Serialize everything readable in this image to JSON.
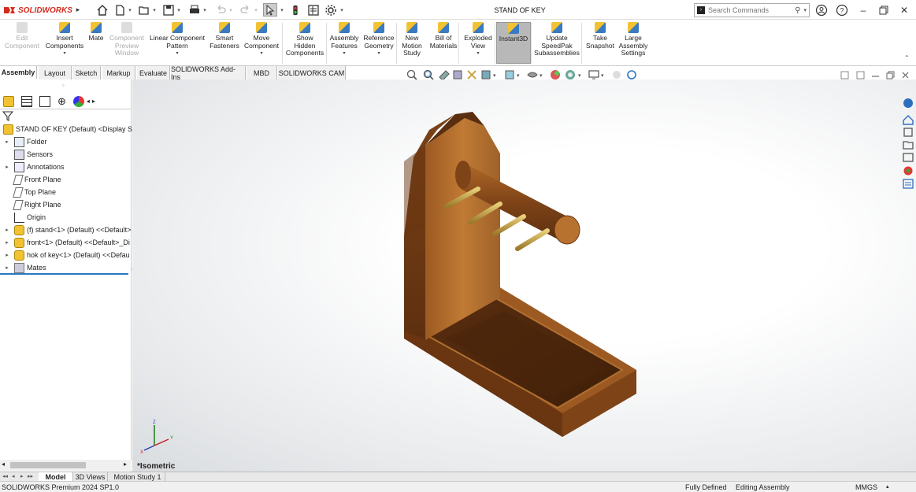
{
  "app": {
    "logo_text": "SOLIDWORKS",
    "document_title": "STAND OF KEY"
  },
  "search": {
    "placeholder": "Search Commands"
  },
  "ribbon": {
    "buttons": [
      {
        "label": "Edit\nComponent",
        "enabled": false
      },
      {
        "label": "Insert\nComponents",
        "enabled": true
      },
      {
        "label": "Mate",
        "enabled": true
      },
      {
        "label": "Component\nPreview\nWindow",
        "enabled": false
      },
      {
        "label": "Linear Component\nPattern",
        "enabled": true
      },
      {
        "label": "Smart\nFasteners",
        "enabled": true
      },
      {
        "label": "Move\nComponent",
        "enabled": true
      },
      {
        "label": "Show\nHidden\nComponents",
        "enabled": true
      },
      {
        "label": "Assembly\nFeatures",
        "enabled": true
      },
      {
        "label": "Reference\nGeometry",
        "enabled": true
      },
      {
        "label": "New\nMotion\nStudy",
        "enabled": true
      },
      {
        "label": "Bill of\nMaterials",
        "enabled": true
      },
      {
        "label": "Exploded\nView",
        "enabled": true
      },
      {
        "label": "Instant3D",
        "enabled": true,
        "active": true
      },
      {
        "label": "Update\nSpeedPak\nSubassemblies",
        "enabled": true
      },
      {
        "label": "Take\nSnapshot",
        "enabled": true
      },
      {
        "label": "Large\nAssembly\nSettings",
        "enabled": true
      }
    ]
  },
  "tabs": [
    "Assembly",
    "Layout",
    "Sketch",
    "Markup",
    "Evaluate",
    "SOLIDWORKS Add-Ins",
    "MBD",
    "SOLIDWORKS CAM"
  ],
  "tree": {
    "root": "STAND OF KEY (Default) <Display Stat",
    "items": [
      {
        "label": "Folder",
        "expand": true
      },
      {
        "label": "Sensors",
        "expand": false
      },
      {
        "label": "Annotations",
        "expand": true
      },
      {
        "label": "Front Plane",
        "expand": false
      },
      {
        "label": "Top Plane",
        "expand": false
      },
      {
        "label": "Right Plane",
        "expand": false
      },
      {
        "label": "Origin",
        "expand": false
      },
      {
        "label": "(f) stand<1> (Default) <<Default>",
        "expand": true
      },
      {
        "label": "front<1> (Default) <<Default>_Di",
        "expand": true
      },
      {
        "label": "hok of key<1> (Default) <<Defau",
        "expand": true
      },
      {
        "label": "Mates",
        "expand": true
      }
    ]
  },
  "viewport": {
    "view_label": "*Isometric",
    "triad": {
      "x": "X",
      "y": "Y",
      "z": "Z"
    }
  },
  "bottom_tabs": [
    "Model",
    "3D Views",
    "Motion Study 1"
  ],
  "status": {
    "product": "SOLIDWORKS Premium 2024 SP1.0",
    "state": "Fully Defined",
    "mode": "Editing Assembly",
    "units": "MMGS"
  },
  "colors": {
    "accent": "#2b78c2",
    "brand_red": "#d42b1e",
    "wood_dark": "#6b3a14",
    "wood_mid": "#9a5a22",
    "wood_light": "#b8722f",
    "brass": "#c9a64a"
  }
}
